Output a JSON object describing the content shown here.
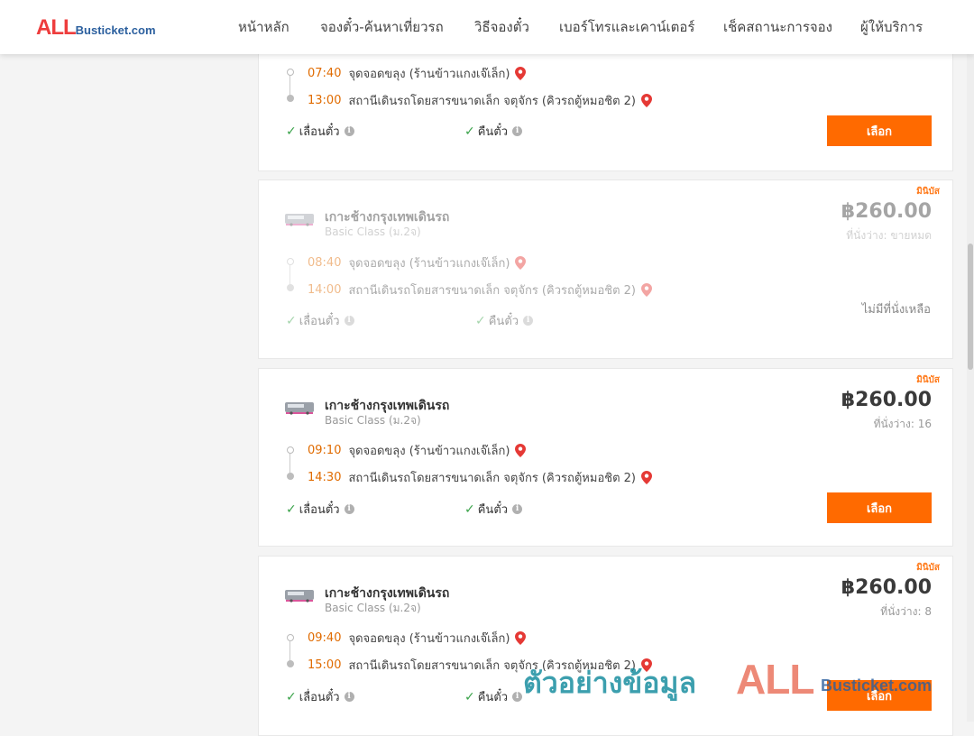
{
  "header": {
    "logo_all": "ALL",
    "logo_rest": "Busticket.com",
    "nav": [
      "หน้าหลัก",
      "จองตั๋ว-ค้นหาเที่ยวรถ",
      "วิธีจองตั๋ว",
      "เบอร์โทรและเคาน์เตอร์",
      "เช็คสถานะการจอง",
      "ผู้ให้บริการ"
    ]
  },
  "cards": [
    {
      "depart_time": "07:40",
      "depart_place": "จุดจอดขลุง (ร้านข้าวแกงเจ๊เล็ก)",
      "arrive_time": "13:00",
      "arrive_place": "สถานีเดินรถโดยสารขนาดเล็ก จตุจักร (คิวรถตู้หมอชิต 2)",
      "feature_change": "เลื่อนตั๋ว",
      "feature_refund": "คืนตั๋ว",
      "button": "เลือก"
    },
    {
      "mini_label": "มินิบัส",
      "company": "เกาะช้างกรุงเทพเดินรถ",
      "class": "Basic Class (ม.2จ)",
      "price": "฿260.00",
      "seats": "ที่นั่งว่าง: ขายหมด",
      "depart_time": "08:40",
      "depart_place": "จุดจอดขลุง (ร้านข้าวแกงเจ๊เล็ก)",
      "arrive_time": "14:00",
      "arrive_place": "สถานีเดินรถโดยสารขนาดเล็ก จตุจักร (คิวรถตู้หมอชิต 2)",
      "feature_change": "เลื่อนตั๋ว",
      "feature_refund": "คืนตั๋ว",
      "no_seat": "ไม่มีที่นั่งเหลือ"
    },
    {
      "mini_label": "มินิบัส",
      "company": "เกาะช้างกรุงเทพเดินรถ",
      "class": "Basic Class (ม.2จ)",
      "price": "฿260.00",
      "seats": "ที่นั่งว่าง: 16",
      "depart_time": "09:10",
      "depart_place": "จุดจอดขลุง (ร้านข้าวแกงเจ๊เล็ก)",
      "arrive_time": "14:30",
      "arrive_place": "สถานีเดินรถโดยสารขนาดเล็ก จตุจักร (คิวรถตู้หมอชิต 2)",
      "feature_change": "เลื่อนตั๋ว",
      "feature_refund": "คืนตั๋ว",
      "button": "เลือก"
    },
    {
      "mini_label": "มินิบัส",
      "company": "เกาะช้างกรุงเทพเดินรถ",
      "class": "Basic Class (ม.2จ)",
      "price": "฿260.00",
      "seats": "ที่นั่งว่าง: 8",
      "depart_time": "09:40",
      "depart_place": "จุดจอดขลุง (ร้านข้าวแกงเจ๊เล็ก)",
      "arrive_time": "15:00",
      "arrive_place": "สถานีเดินรถโดยสารขนาดเล็ก จตุจักร (คิวรถตู้หมอชิต 2)",
      "feature_change": "เลื่อนตั๋ว",
      "feature_refund": "คืนตั๋ว",
      "button": "เลือก"
    }
  ],
  "watermark": {
    "thai": "ตัวอย่างข้อมูล",
    "all": "ALL",
    "rest": "Busticket.com"
  },
  "colors": {
    "accent": "#ff6a00",
    "time": "#e06b00",
    "mini_label": "#ff7a1a",
    "check": "#3aa34a",
    "pin": "#e53935",
    "logo_red": "#ee3d3d",
    "logo_blue": "#2b5f9e"
  },
  "icons": {
    "pin": "map-pin-icon",
    "check": "check-icon",
    "info": "info-icon",
    "bus_logo": "bus-company-logo"
  }
}
